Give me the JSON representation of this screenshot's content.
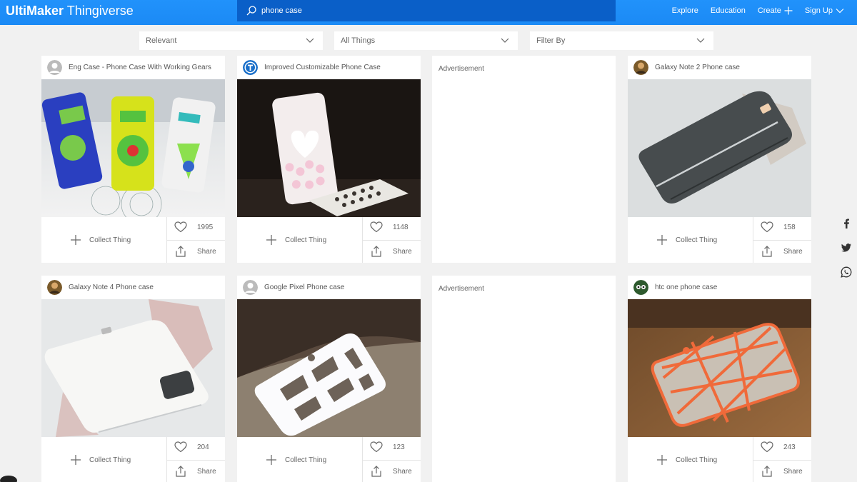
{
  "header": {
    "brand": "UltiMaker",
    "product": "Thingiverse",
    "search_value": "phone case",
    "nav": {
      "explore": "Explore",
      "education": "Education",
      "create": "Create",
      "signup": "Sign Up"
    }
  },
  "filters": {
    "sort": "Relevant",
    "type": "All Things",
    "filter": "Filter By"
  },
  "ad_label": "Advertisement",
  "collect_label": "Collect Thing",
  "share_label": "Share",
  "cards": [
    {
      "title": "Eng Case - Phone Case With Working Gears",
      "likes": "1995"
    },
    {
      "title": "Improved Customizable Phone Case",
      "likes": "1148"
    },
    {
      "title": "Galaxy Note 2 Phone case",
      "likes": "158"
    },
    {
      "title": "Galaxy Note 4 Phone case",
      "likes": "204"
    },
    {
      "title": "Google Pixel Phone case",
      "likes": "123"
    },
    {
      "title": "htc one phone case",
      "likes": "243"
    }
  ],
  "colors": {
    "header": "#1e90ff",
    "search_bg": "#0a5fc8",
    "page_bg": "#f1f1f1"
  }
}
